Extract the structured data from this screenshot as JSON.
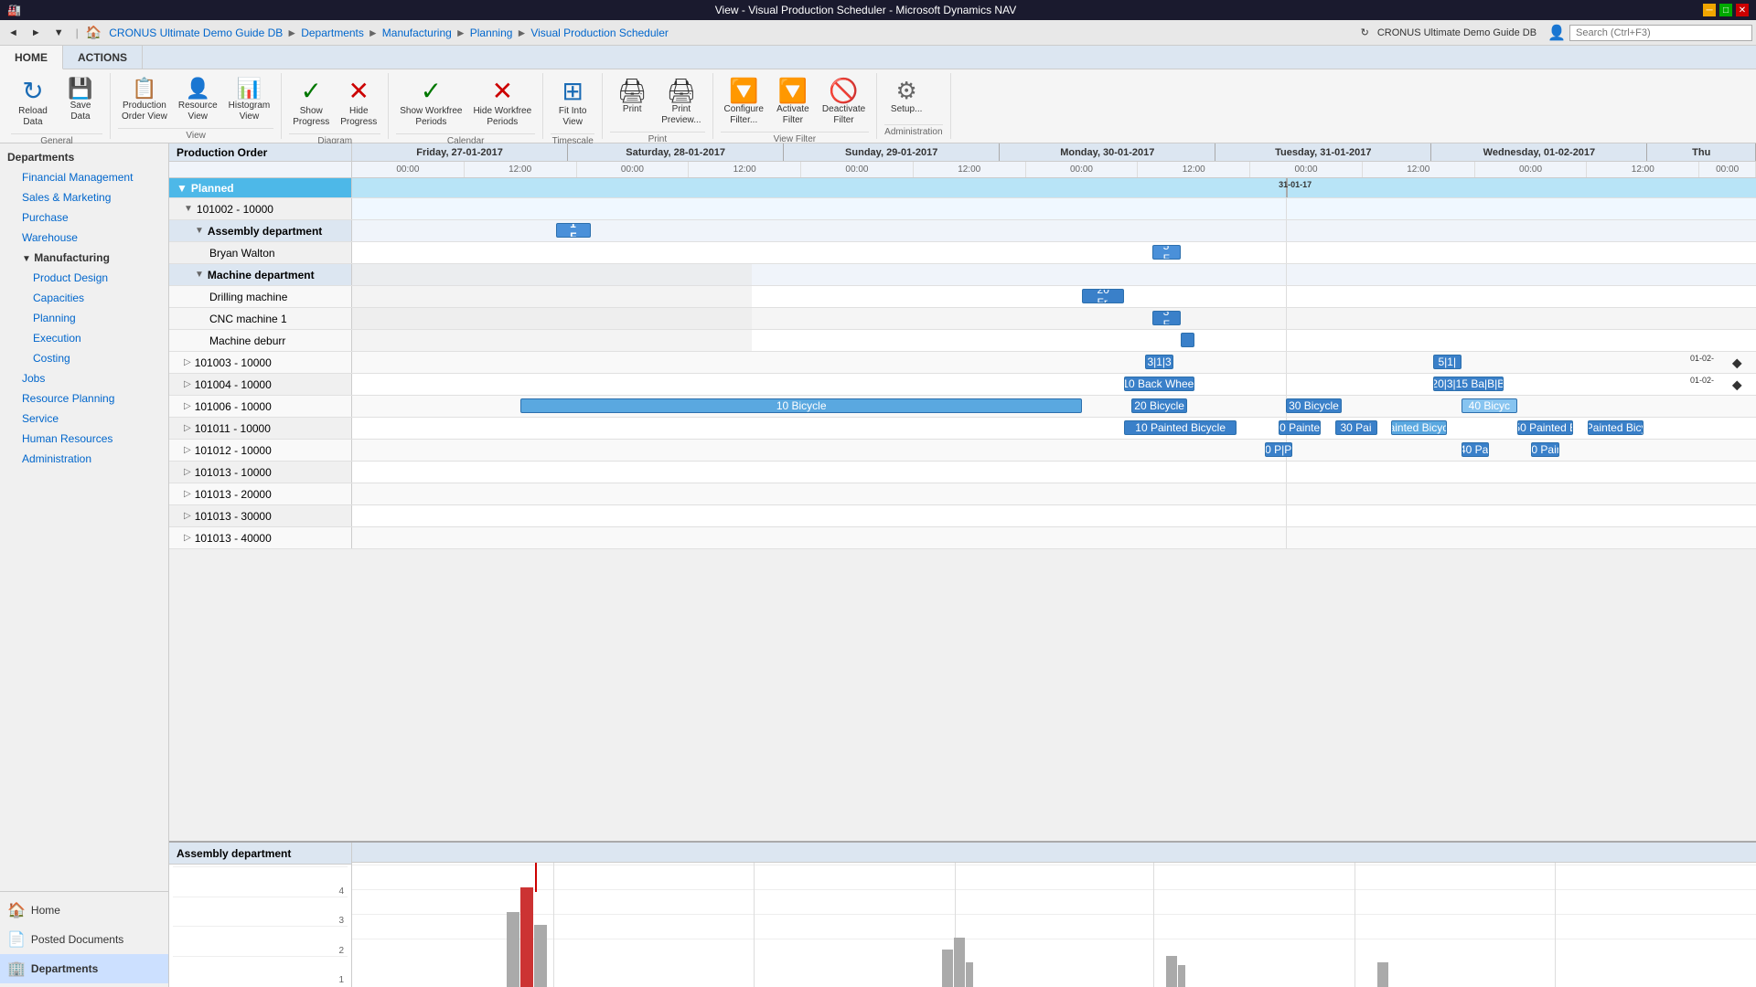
{
  "window": {
    "title": "View - Visual Production Scheduler - Microsoft Dynamics NAV",
    "min_btn": "─",
    "max_btn": "□",
    "close_btn": "✕"
  },
  "navbar": {
    "back_label": "◄",
    "forward_label": "►",
    "dropdown_label": "▼",
    "breadcrumb": [
      "CRONUS Ultimate Demo Guide DB",
      "Departments",
      "Manufacturing",
      "Planning",
      "Visual Production Scheduler"
    ],
    "search_placeholder": "Search (Ctrl+F3)",
    "company": "CRONUS Ultimate Demo Guide DB"
  },
  "ribbon": {
    "tabs": [
      "HOME",
      "ACTIONS"
    ],
    "active_tab": "HOME",
    "groups": [
      {
        "name": "General",
        "items": [
          {
            "id": "reload",
            "icon": "↻",
            "label": "Reload\nData",
            "color": "blue"
          },
          {
            "id": "save",
            "icon": "💾",
            "label": "Save\nData",
            "color": "blue"
          }
        ]
      },
      {
        "name": "View",
        "items": [
          {
            "id": "production-order-view",
            "icon": "📋",
            "label": "Production\nOrder View",
            "color": "blue"
          },
          {
            "id": "resource-view",
            "icon": "👤",
            "label": "Resource\nView",
            "color": "blue"
          },
          {
            "id": "histogram-view",
            "icon": "📊",
            "label": "Histogram\nView",
            "color": "blue"
          }
        ]
      },
      {
        "name": "Diagram",
        "items": [
          {
            "id": "show-progress",
            "icon": "✓",
            "label": "Show\nProgress",
            "color": "green"
          },
          {
            "id": "hide-progress",
            "icon": "✕",
            "label": "Hide\nProgress",
            "color": "red"
          }
        ]
      },
      {
        "name": "Calendar",
        "items": [
          {
            "id": "show-workfree",
            "icon": "✓",
            "label": "Show Workfree\nPeriods",
            "color": "green"
          },
          {
            "id": "hide-workfree",
            "icon": "✕",
            "label": "Hide Workfree\nPeriods",
            "color": "red"
          }
        ]
      },
      {
        "name": "Timescale",
        "items": [
          {
            "id": "fit-into-view",
            "icon": "⊞",
            "label": "Fit Into\nView",
            "color": "blue"
          }
        ]
      },
      {
        "name": "Print",
        "items": [
          {
            "id": "print",
            "icon": "🖨",
            "label": "Print",
            "color": "blue"
          },
          {
            "id": "print-preview",
            "icon": "🖨",
            "label": "Print\nPreview...",
            "color": "blue"
          }
        ]
      },
      {
        "name": "View Filter",
        "items": [
          {
            "id": "configure-filter",
            "icon": "🔽",
            "label": "Configure\nFilter...",
            "color": "blue"
          },
          {
            "id": "activate-filter",
            "icon": "🔽",
            "label": "Activate\nFilter",
            "color": "blue"
          },
          {
            "id": "deactivate-filter",
            "icon": "🚫",
            "label": "Deactivate\nFilter",
            "color": "gray"
          }
        ]
      },
      {
        "name": "Administration",
        "items": [
          {
            "id": "setup",
            "icon": "⚙",
            "label": "Setup...",
            "color": "blue"
          }
        ]
      }
    ]
  },
  "sidebar": {
    "items": [
      {
        "id": "departments",
        "label": "Departments",
        "level": 0,
        "type": "header"
      },
      {
        "id": "financial",
        "label": "Financial Management",
        "level": 1
      },
      {
        "id": "sales",
        "label": "Sales & Marketing",
        "level": 1
      },
      {
        "id": "purchase",
        "label": "Purchase",
        "level": 1
      },
      {
        "id": "warehouse",
        "label": "Warehouse",
        "level": 1
      },
      {
        "id": "manufacturing",
        "label": "Manufacturing",
        "level": 1,
        "expanded": true
      },
      {
        "id": "product-design",
        "label": "Product Design",
        "level": 2
      },
      {
        "id": "capacities",
        "label": "Capacities",
        "level": 2
      },
      {
        "id": "planning",
        "label": "Planning",
        "level": 2
      },
      {
        "id": "execution",
        "label": "Execution",
        "level": 2
      },
      {
        "id": "costing",
        "label": "Costing",
        "level": 2
      },
      {
        "id": "jobs",
        "label": "Jobs",
        "level": 1
      },
      {
        "id": "resource-planning",
        "label": "Resource Planning",
        "level": 1
      },
      {
        "id": "service",
        "label": "Service",
        "level": 1
      },
      {
        "id": "human-resources",
        "label": "Human Resources",
        "level": 1
      },
      {
        "id": "administration",
        "label": "Administration",
        "level": 1
      }
    ],
    "bottom": [
      {
        "id": "home",
        "label": "Home",
        "icon": "🏠"
      },
      {
        "id": "posted-documents",
        "label": "Posted Documents",
        "icon": "📄"
      },
      {
        "id": "dept-active",
        "label": "Departments",
        "icon": "🏢",
        "active": true
      }
    ]
  },
  "gantt": {
    "header": {
      "label_col": "Production Order",
      "days": [
        {
          "label": "Friday, 27-01-2017",
          "sub": [
            "00:00",
            "12:00"
          ]
        },
        {
          "label": "Saturday, 28-01-2017",
          "sub": [
            "00:00",
            "12:00"
          ]
        },
        {
          "label": "Sunday, 29-01-2017",
          "sub": [
            "00:00",
            "12:00"
          ]
        },
        {
          "label": "Monday, 30-01-2017",
          "sub": [
            "00:00",
            "12:00"
          ]
        },
        {
          "label": "Tuesday, 31-01-2017",
          "sub": [
            "00:00",
            "12:00"
          ]
        },
        {
          "label": "Wednesday, 01-02-2017",
          "sub": [
            "00:00",
            "12:00"
          ]
        },
        {
          "label": "Thu",
          "sub": [
            "00:00"
          ]
        }
      ]
    },
    "current_time_label": "31-01-17",
    "rows": [
      {
        "id": "planned",
        "label": "▼ Planned",
        "type": "section",
        "indent": 0
      },
      {
        "id": "101002",
        "label": "▼ 101002 - 10000",
        "type": "order",
        "indent": 1
      },
      {
        "id": "assembly-dept",
        "label": "▼ Assembly department",
        "type": "dept",
        "indent": 2
      },
      {
        "id": "bryan-walton",
        "label": "Bryan Walton",
        "type": "resource",
        "indent": 3
      },
      {
        "id": "machine-dept",
        "label": "▼ Machine department",
        "type": "dept",
        "indent": 2
      },
      {
        "id": "drilling",
        "label": "Drilling machine",
        "type": "machine",
        "indent": 3
      },
      {
        "id": "cnc1",
        "label": "CNC machine 1",
        "type": "machine",
        "indent": 3
      },
      {
        "id": "machine-deburr",
        "label": "Machine deburr",
        "type": "machine",
        "indent": 3
      },
      {
        "id": "101003",
        "label": "▷ 101003 - 10000",
        "type": "order-collapsed",
        "indent": 1
      },
      {
        "id": "101004",
        "label": "▷ 101004 - 10000",
        "type": "order-collapsed",
        "indent": 1
      },
      {
        "id": "101006",
        "label": "▷ 101006 - 10000",
        "type": "order-collapsed",
        "indent": 1
      },
      {
        "id": "101011",
        "label": "▷ 101011 - 10000",
        "type": "order-collapsed",
        "indent": 1
      },
      {
        "id": "101012",
        "label": "▷ 101012 - 10000",
        "type": "order-collapsed",
        "indent": 1
      },
      {
        "id": "101013-10000",
        "label": "▷ 101013 - 10000",
        "type": "order-collapsed",
        "indent": 1
      },
      {
        "id": "101013-20000",
        "label": "▷ 101013 - 20000",
        "type": "order-collapsed",
        "indent": 1
      },
      {
        "id": "101013-30000",
        "label": "▷ 101013 - 30000",
        "type": "order-collapsed",
        "indent": 1
      },
      {
        "id": "101013-40000",
        "label": "▷ 101013 - 40000",
        "type": "order-collapsed",
        "indent": 1
      }
    ]
  },
  "histogram": {
    "title": "Assembly department",
    "scale": [
      "4",
      "3",
      "2",
      "1"
    ],
    "bars": [
      {
        "day_offset": 0.3,
        "height_pct": 70,
        "label": ""
      },
      {
        "day_offset": 0.35,
        "height_pct": 85,
        "label": "",
        "red": true
      },
      {
        "day_offset": 0.4,
        "height_pct": 60,
        "label": ""
      },
      {
        "day_offset": 2.8,
        "height_pct": 40,
        "label": ""
      },
      {
        "day_offset": 2.85,
        "height_pct": 50,
        "label": ""
      },
      {
        "day_offset": 4.0,
        "height_pct": 35,
        "label": ""
      },
      {
        "day_offset": 4.05,
        "height_pct": 30,
        "label": ""
      },
      {
        "day_offset": 5.2,
        "height_pct": 25,
        "label": ""
      }
    ]
  }
}
